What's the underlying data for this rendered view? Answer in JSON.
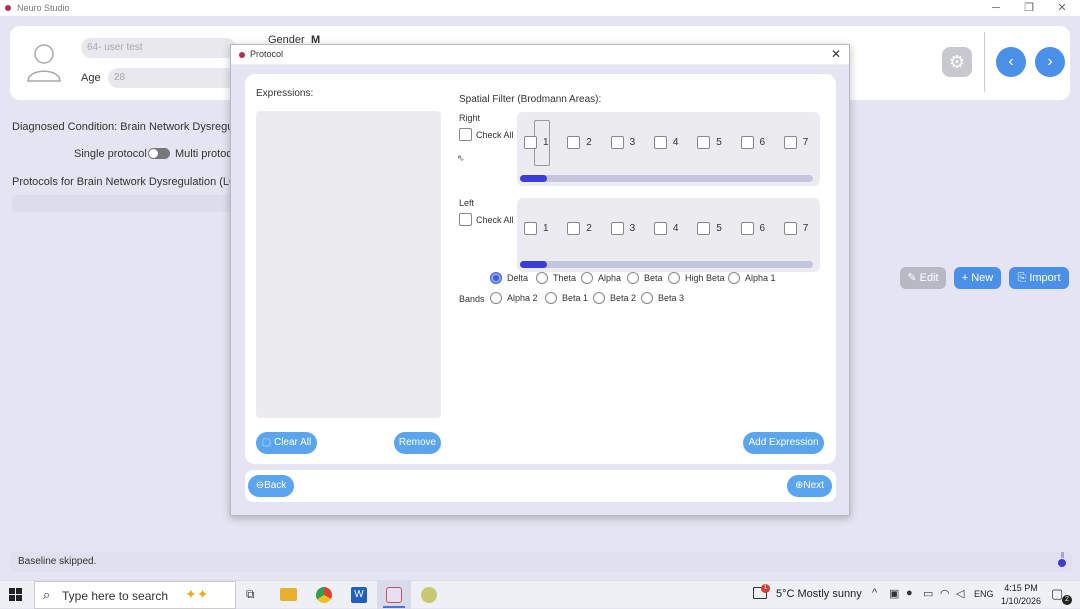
{
  "window": {
    "title": "Neuro Studio",
    "minimize": "─",
    "restore": "❐",
    "close": "✕"
  },
  "profile": {
    "user_field": "64- user test",
    "age_label": "Age",
    "age_value": "28",
    "gender_label": "Gender",
    "gender_value": "M"
  },
  "background": {
    "diagnosed": "Diagnosed Condition: Brain Network Dysregulatio",
    "single_protocol": "Single protocol",
    "multi_protocol": "Multi protoc",
    "protocols_for": "Protocols for Brain Network Dysregulation (LORE",
    "edit_label": "Edit",
    "new_label": "New",
    "import_label": "Import",
    "status": "Baseline skipped."
  },
  "dialog": {
    "title": "Protocol",
    "close": "✕",
    "expressions_label": "Expressions:",
    "spatial_filter_label": "Spatial Filter (Brodmann Areas):",
    "right_label": "Right",
    "left_label": "Left",
    "check_all": "Check All",
    "areas": [
      "1",
      "2",
      "3",
      "4",
      "5",
      "6",
      "7"
    ],
    "bands_label": "Bands",
    "bands_row1": [
      "Delta",
      "Theta",
      "Alpha",
      "Beta",
      "High Beta",
      "Alpha 1"
    ],
    "bands_row2": [
      "Alpha 2",
      "Beta 1",
      "Beta 2",
      "Beta 3"
    ],
    "selected_band": "Delta",
    "clear_all": "Clear All",
    "remove": "Remove",
    "add_expression": "Add Expression",
    "back": "Back",
    "next": "Next"
  },
  "taskbar": {
    "search_placeholder": "Type here to search",
    "weather": "5°C  Mostly sunny",
    "weather_badge": "1",
    "language": "ENG",
    "time": "4:15 PM",
    "date": "1/10/2026",
    "notification_count": "2"
  },
  "colors": {
    "accent": "#4a90e8",
    "selected_radio": "#3c5fe0",
    "scroll_thumb": "#3c3cd8"
  }
}
